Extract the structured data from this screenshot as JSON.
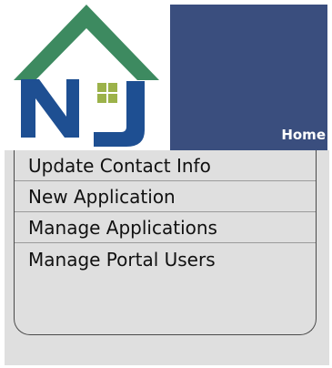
{
  "header": {
    "logo_name": "nj-housing-logo",
    "home_label": "Home",
    "colors": {
      "header_bg": "#3a4e7e",
      "logo_roof": "#3d8a60",
      "logo_letters": "#1e4f92",
      "logo_window": "#9cb24a"
    }
  },
  "menu": {
    "items": [
      {
        "label": "Update Contact Info"
      },
      {
        "label": "New Application"
      },
      {
        "label": "Manage Applications"
      },
      {
        "label": "Manage Portal Users"
      }
    ]
  }
}
